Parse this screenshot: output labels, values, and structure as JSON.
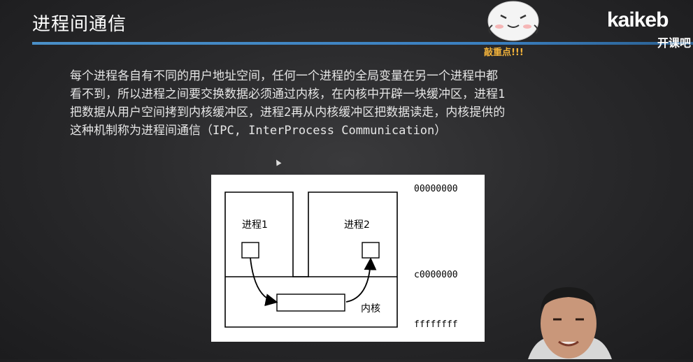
{
  "slide": {
    "title": "进程间通信",
    "body": "每个进程各自有不同的用户地址空间，任何一个进程的全局变量在另一个进程中都\n看不到，所以进程之间要交换数据必须通过内核，在内核中开辟一块缓冲区，进程1\n把数据从用户空间拷到内核缓冲区，进程2再从内核缓冲区把数据读走，内核提供的\n这种机制称为进程间通信（IPC, InterProcess Communication）"
  },
  "sticker": {
    "label": "敲重点!!!"
  },
  "logo": {
    "mark": "kaikeb",
    "sub": "开课吧"
  },
  "diagram": {
    "process1": "进程1",
    "process2": "进程2",
    "kernel": "内核",
    "addr_top": "00000000",
    "addr_mid": "c0000000",
    "addr_bottom": "ffffffff"
  },
  "colors": {
    "accent_rule": "#3a7fc0",
    "sticker_label": "#f2b23a"
  }
}
